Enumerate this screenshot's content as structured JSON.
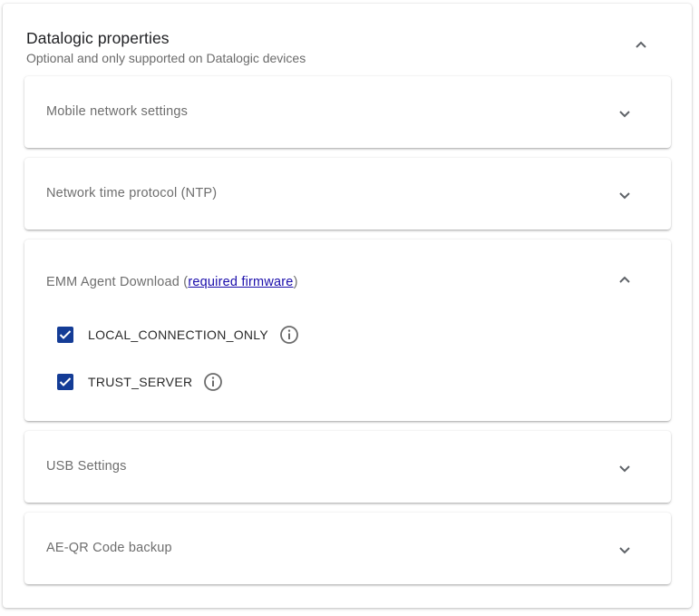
{
  "section": {
    "title": "Datalogic properties",
    "subtitle": "Optional and only supported on Datalogic devices",
    "expanded": true
  },
  "panels": [
    {
      "title": "Mobile network settings",
      "expanded": false
    },
    {
      "title": "Network time protocol (NTP)",
      "expanded": false
    },
    {
      "title": "EMM Agent Download",
      "title_open_paren": " (",
      "link_text": "required firmware",
      "title_close_paren": ")",
      "expanded": true,
      "options": [
        {
          "label": "LOCAL_CONNECTION_ONLY",
          "checked": true
        },
        {
          "label": "TRUST_SERVER",
          "checked": true
        }
      ]
    },
    {
      "title": "USB Settings",
      "expanded": false
    },
    {
      "title": "AE-QR Code backup",
      "expanded": false
    }
  ],
  "colors": {
    "checkbox": "#143c96",
    "link": "#1a0dab",
    "icon": "#6b6b6b"
  },
  "icons": {
    "collapse": "chevron-up-icon",
    "expand": "chevron-down-icon",
    "check": "checkmark-icon",
    "info": "info-circle-icon"
  }
}
